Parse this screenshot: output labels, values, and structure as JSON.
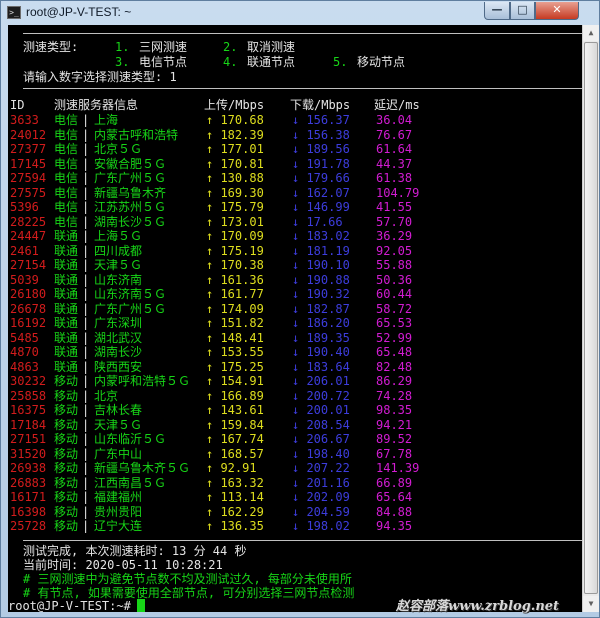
{
  "window": {
    "title": "root@JP-V-TEST: ~",
    "title_icon": "terminal-icon",
    "controls": {
      "minimize": "—",
      "maximize": "□",
      "close": "✕"
    }
  },
  "menu": {
    "type_label": "测速类型:",
    "options": [
      {
        "key": "1.",
        "label": "三网测速"
      },
      {
        "key": "2.",
        "label": "取消测速"
      },
      {
        "key": "3.",
        "label": "电信节点"
      },
      {
        "key": "4.",
        "label": "联通节点"
      },
      {
        "key": "5.",
        "label": "移动节点"
      }
    ],
    "prompt": "请输入数字选择测速类型: 1"
  },
  "table": {
    "headers": {
      "id": "ID",
      "server": "测速服务器信息",
      "upload": "上传/Mbps",
      "download": "下载/Mbps",
      "latency": "延迟/ms"
    },
    "rows": [
      {
        "id": "3633",
        "isp": "电信",
        "loc": "上海",
        "up": "↑ 170.68",
        "down": "↓ 156.37",
        "ping": "36.04"
      },
      {
        "id": "24012",
        "isp": "电信",
        "loc": "内蒙古呼和浩特",
        "up": "↑ 182.39",
        "down": "↓ 156.38",
        "ping": "76.67"
      },
      {
        "id": "27377",
        "isp": "电信",
        "loc": "北京５Ｇ",
        "up": "↑ 177.01",
        "down": "↓ 189.56",
        "ping": "61.64"
      },
      {
        "id": "17145",
        "isp": "电信",
        "loc": "安徽合肥５Ｇ",
        "up": "↑ 170.81",
        "down": "↓ 191.78",
        "ping": "44.37"
      },
      {
        "id": "27594",
        "isp": "电信",
        "loc": "广东广州５Ｇ",
        "up": "↑ 130.88",
        "down": "↓ 179.66",
        "ping": "61.38"
      },
      {
        "id": "27575",
        "isp": "电信",
        "loc": "新疆乌鲁木齐",
        "up": "↑ 169.30",
        "down": "↓ 162.07",
        "ping": "104.79"
      },
      {
        "id": "5396",
        "isp": "电信",
        "loc": "江苏苏州５Ｇ",
        "up": "↑ 175.79",
        "down": "↓ 146.99",
        "ping": "41.55"
      },
      {
        "id": "28225",
        "isp": "电信",
        "loc": "湖南长沙５Ｇ",
        "up": "↑ 173.01",
        "down": "↓ 17.66",
        "ping": "57.70"
      },
      {
        "id": "24447",
        "isp": "联通",
        "loc": "上海５Ｇ",
        "up": "↑ 170.09",
        "down": "↓ 183.02",
        "ping": "36.29"
      },
      {
        "id": "2461",
        "isp": "联通",
        "loc": "四川成都",
        "up": "↑ 175.19",
        "down": "↓ 181.19",
        "ping": "92.05"
      },
      {
        "id": "27154",
        "isp": "联通",
        "loc": "天津５Ｇ",
        "up": "↑ 170.38",
        "down": "↓ 190.10",
        "ping": "55.88"
      },
      {
        "id": "5039",
        "isp": "联通",
        "loc": "山东济南",
        "up": "↑ 161.36",
        "down": "↓ 190.88",
        "ping": "50.36"
      },
      {
        "id": "26180",
        "isp": "联通",
        "loc": "山东济南５Ｇ",
        "up": "↑ 161.77",
        "down": "↓ 190.32",
        "ping": "60.44"
      },
      {
        "id": "26678",
        "isp": "联通",
        "loc": "广东广州５Ｇ",
        "up": "↑ 174.09",
        "down": "↓ 182.87",
        "ping": "58.72"
      },
      {
        "id": "16192",
        "isp": "联通",
        "loc": "广东深圳",
        "up": "↑ 151.82",
        "down": "↓ 186.20",
        "ping": "65.53"
      },
      {
        "id": "5485",
        "isp": "联通",
        "loc": "湖北武汉",
        "up": "↑ 148.41",
        "down": "↓ 189.35",
        "ping": "52.99"
      },
      {
        "id": "4870",
        "isp": "联通",
        "loc": "湖南长沙",
        "up": "↑ 153.55",
        "down": "↓ 190.40",
        "ping": "65.48"
      },
      {
        "id": "4863",
        "isp": "联通",
        "loc": "陕西西安",
        "up": "↑ 175.25",
        "down": "↓ 183.64",
        "ping": "82.48"
      },
      {
        "id": "30232",
        "isp": "移动",
        "loc": "内蒙呼和浩特５Ｇ",
        "up": "↑ 154.91",
        "down": "↓ 206.01",
        "ping": "86.29"
      },
      {
        "id": "25858",
        "isp": "移动",
        "loc": "北京",
        "up": "↑ 166.89",
        "down": "↓ 200.72",
        "ping": "74.28"
      },
      {
        "id": "16375",
        "isp": "移动",
        "loc": "吉林长春",
        "up": "↑ 143.61",
        "down": "↓ 200.01",
        "ping": "98.35"
      },
      {
        "id": "17184",
        "isp": "移动",
        "loc": "天津５Ｇ",
        "up": "↑ 159.84",
        "down": "↓ 208.54",
        "ping": "94.21"
      },
      {
        "id": "27151",
        "isp": "移动",
        "loc": "山东临沂５Ｇ",
        "up": "↑ 167.74",
        "down": "↓ 206.67",
        "ping": "89.52"
      },
      {
        "id": "31520",
        "isp": "移动",
        "loc": "广东中山",
        "up": "↑ 168.57",
        "down": "↓ 198.40",
        "ping": "67.78"
      },
      {
        "id": "26938",
        "isp": "移动",
        "loc": "新疆乌鲁木齐５Ｇ",
        "up": "↑ 92.91",
        "down": "↓ 207.22",
        "ping": "141.39"
      },
      {
        "id": "26883",
        "isp": "移动",
        "loc": "江西南昌５Ｇ",
        "up": "↑ 163.32",
        "down": "↓ 201.16",
        "ping": "66.89"
      },
      {
        "id": "16171",
        "isp": "移动",
        "loc": "福建福州",
        "up": "↑ 113.14",
        "down": "↓ 202.09",
        "ping": "65.64"
      },
      {
        "id": "16398",
        "isp": "移动",
        "loc": "贵州贵阳",
        "up": "↑ 162.29",
        "down": "↓ 204.59",
        "ping": "84.88"
      },
      {
        "id": "25728",
        "isp": "移动",
        "loc": "辽宁大连",
        "up": "↑ 136.35",
        "down": "↓ 198.02",
        "ping": "94.35"
      }
    ]
  },
  "footer": {
    "done": "测试完成, 本次测速耗时: 13 分 44 秒",
    "time": "当前时间: 2020-05-11 10:28:21",
    "note1": "# 三网测速中为避免节点数不均及测试过久, 每部分未使用所",
    "note2": "# 有节点, 如果需要使用全部节点, 可分别选择三网节点检测"
  },
  "prompt": "root@JP-V-TEST:~#",
  "watermark": "赵容部落www.zrblog.net",
  "colors": {
    "id": "#d21c1c",
    "info": "#17d517",
    "upload": "#dede1e",
    "download": "#3d3ddc",
    "latency": "#d21cd2"
  }
}
